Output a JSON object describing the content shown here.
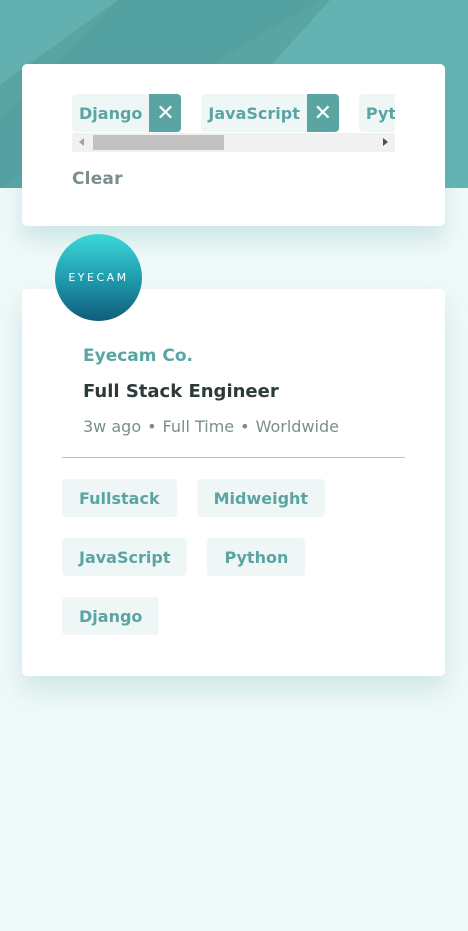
{
  "filters": {
    "tags": [
      "Django",
      "JavaScript",
      "Python"
    ],
    "remove_icon": "close-icon",
    "clear_label": "Clear"
  },
  "job": {
    "logo_text": "EYECAM",
    "company": "Eyecam Co.",
    "position": "Full Stack Engineer",
    "posted": "3w ago",
    "separator": "•",
    "contract": "Full Time",
    "location": "Worldwide",
    "tags": [
      "Fullstack",
      "Midweight",
      "JavaScript",
      "Python",
      "Django"
    ]
  },
  "colors": {
    "primary": "#5ba4a4",
    "background": "#eff9f9",
    "tag_bg": "#eff6f6",
    "dark_text": "#2c3a3a",
    "muted_text": "#7b8e8e"
  }
}
